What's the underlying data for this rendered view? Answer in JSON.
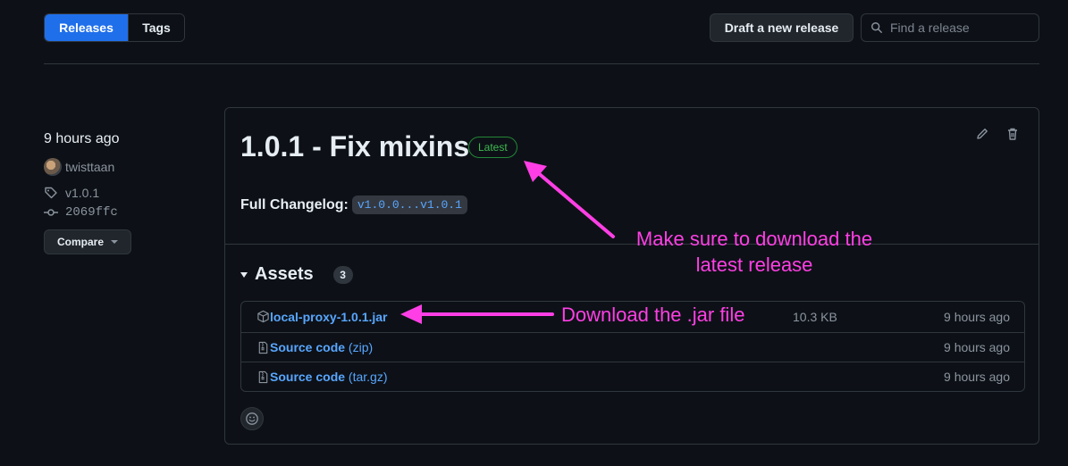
{
  "tabs": {
    "releases": "Releases",
    "tags": "Tags"
  },
  "toolbar": {
    "draft_label": "Draft a new release",
    "search_placeholder": "Find a release"
  },
  "release": {
    "time": "9 hours ago",
    "author": "twisttaan",
    "tag": "v1.0.1",
    "commit": "2069ffc",
    "compare_label": "Compare",
    "title": "1.0.1 - Fix mixins",
    "badge": "Latest",
    "changelog_label": "Full Changelog:",
    "changelog_range": "v1.0.0...v1.0.1"
  },
  "assets": {
    "title": "Assets",
    "count": "3",
    "items": [
      {
        "name": "local-proxy-1.0.1.jar",
        "suffix": "",
        "size": "10.3 KB",
        "time": "9 hours ago",
        "icon": "package-icon"
      },
      {
        "name": "Source code",
        "suffix": "(zip)",
        "size": "",
        "time": "9 hours ago",
        "icon": "file-zip-icon"
      },
      {
        "name": "Source code",
        "suffix": "(tar.gz)",
        "size": "",
        "time": "9 hours ago",
        "icon": "file-zip-icon"
      }
    ]
  },
  "annotations": {
    "latest_line1": "Make sure to download the",
    "latest_line2": "latest release",
    "jar": "Download the .jar file",
    "color": "#ff3fe5"
  },
  "colors": {
    "accent": "#1f6feb",
    "link": "#58a6ff",
    "success": "#3fb950",
    "background": "#0d1117"
  }
}
